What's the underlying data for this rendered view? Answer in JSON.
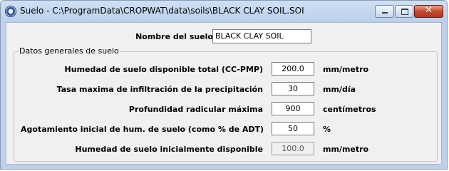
{
  "window": {
    "title": "Suelo - C:\\ProgramData\\CROPWAT\\data\\soils\\BLACK CLAY SOIL.SOI",
    "app_icon": "cropwat-app-icon",
    "controls": {
      "minimize": "minimize-icon",
      "maximize": "maximize-icon",
      "close_glyph": "✕"
    }
  },
  "soil": {
    "name_label": "Nombre del suelo",
    "name_value": "BLACK CLAY SOIL"
  },
  "group": {
    "legend": "Datos generales de suelo",
    "fields": [
      {
        "label": "Humedad de suelo disponible total (CC-PMP)",
        "value": "200.0",
        "unit": "mm/metro"
      },
      {
        "label": "Tasa maxima de infiltración de la precipitación",
        "value": "30",
        "unit": "mm/día"
      },
      {
        "label": "Profundidad radicular máxima",
        "value": "900",
        "unit": "centímetros"
      },
      {
        "label": "Agotamiento inicial de hum. de suelo (como % de ADT)",
        "value": "50",
        "unit": "%"
      },
      {
        "label": "Humedad de suelo inicialmente disponible",
        "value": "100.0",
        "unit": "mm/metro"
      }
    ]
  }
}
